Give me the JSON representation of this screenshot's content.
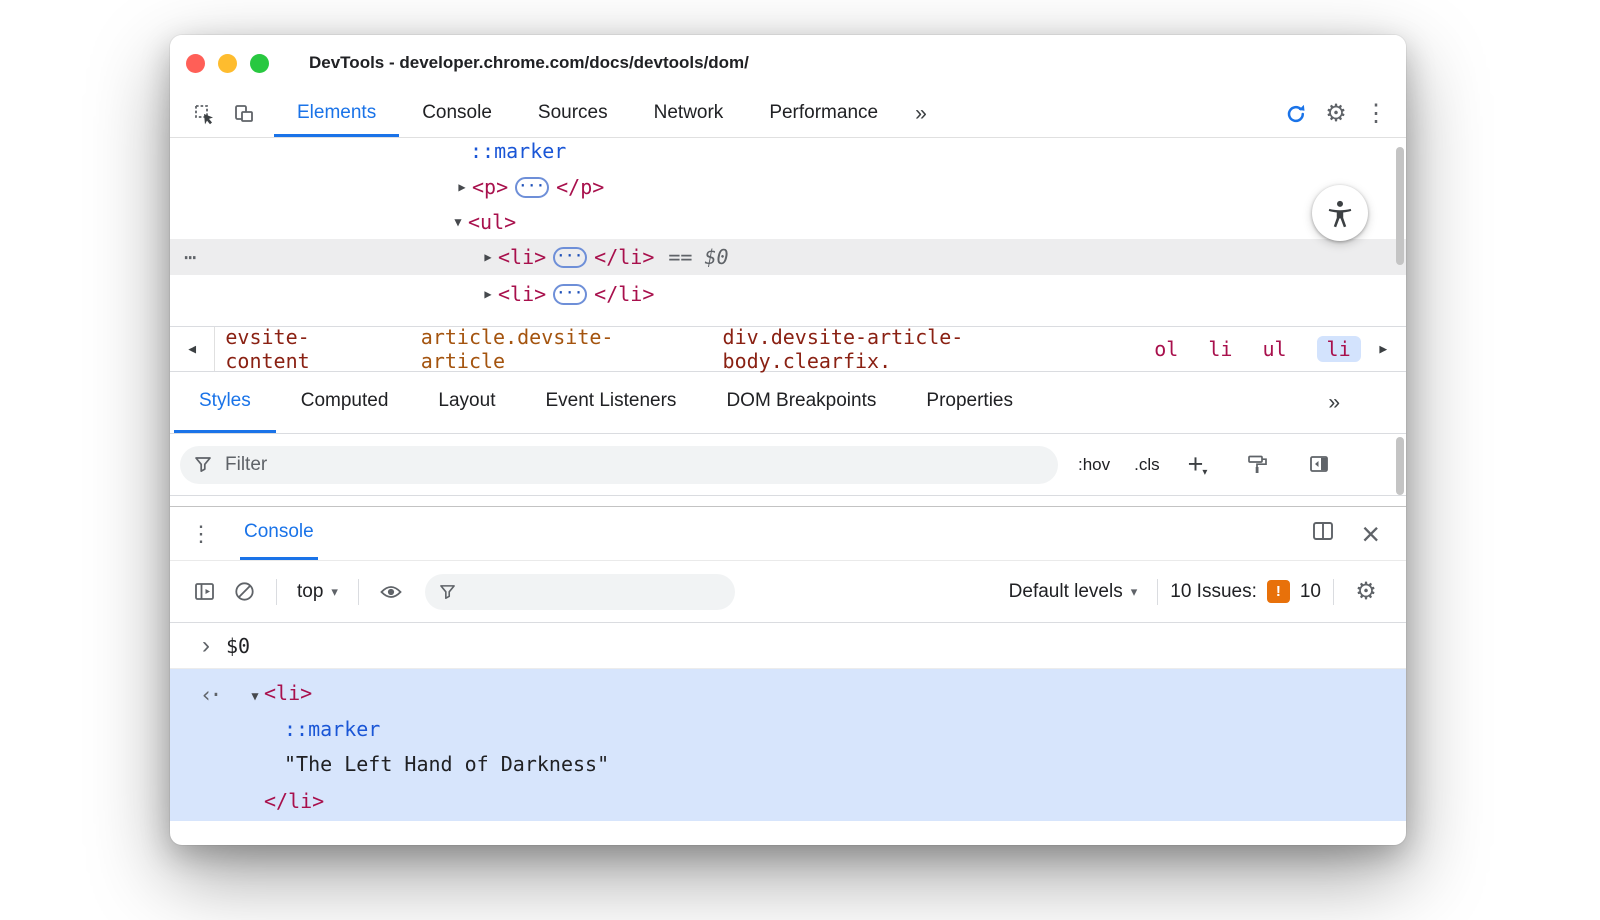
{
  "colors": {
    "accent": "#1a73e8",
    "tag": "#a8104c",
    "pseudo_blue": "#1a56d6",
    "issue_badge": "#e8710a",
    "result_selection_bg": "#d7e5fc",
    "breadcrumb_selected_bg": "#d3e3fd"
  },
  "icons": {
    "caret_down": "▾",
    "more_vert": "⋮",
    "more_horiz": "⋯",
    "gear": "⚙",
    "close": "×",
    "overflow": "»",
    "breadcrumb_prev": "◀",
    "breadcrumb_next": "▶",
    "disclosure_open": "▼",
    "disclosure_closed": "▶",
    "prompt": "›",
    "return_arrow": "‹·",
    "pill_dots": "···",
    "plus": "+"
  },
  "titlebar": {
    "title": "DevTools - developer.chrome.com/docs/devtools/dom/"
  },
  "main_tabs": {
    "items": [
      {
        "label": "Elements"
      },
      {
        "label": "Console"
      },
      {
        "label": "Sources"
      },
      {
        "label": "Network"
      },
      {
        "label": "Performance"
      }
    ]
  },
  "dom_tree": {
    "marker_row": {
      "text": "::marker"
    },
    "p_row": {
      "open": "<p>",
      "close": "</p>"
    },
    "ul_row": {
      "open": "<ul>"
    },
    "li_selected_row": {
      "open": "<li>",
      "close": "</li>",
      "eq": "==",
      "ref": "$0"
    },
    "li_row": {
      "open": "<li>",
      "close": "</li>"
    }
  },
  "breadcrumbs": {
    "items": [
      {
        "label": "evsite-content"
      },
      {
        "label": "article.devsite-article"
      },
      {
        "label": "div.devsite-article-body.clearfix."
      },
      {
        "label": "ol"
      },
      {
        "label": "li"
      },
      {
        "label": "ul"
      },
      {
        "label": "li"
      }
    ]
  },
  "styles_tabs": {
    "items": [
      {
        "label": "Styles"
      },
      {
        "label": "Computed"
      },
      {
        "label": "Layout"
      },
      {
        "label": "Event Listeners"
      },
      {
        "label": "DOM Breakpoints"
      },
      {
        "label": "Properties"
      }
    ]
  },
  "styles_toolbar": {
    "filter_placeholder": "Filter",
    "hov": ":hov",
    "cls": ".cls"
  },
  "console": {
    "tab_label": "Console",
    "context_label": "top",
    "levels_label": "Default levels",
    "issues_label": "10 Issues:",
    "issues_badge_icon": "!",
    "issues_count": "10",
    "prompt_value": "$0",
    "result": {
      "li_open": "<li>",
      "marker": "::marker",
      "string_value": "\"The Left Hand of Darkness\"",
      "li_close": "</li>"
    }
  }
}
